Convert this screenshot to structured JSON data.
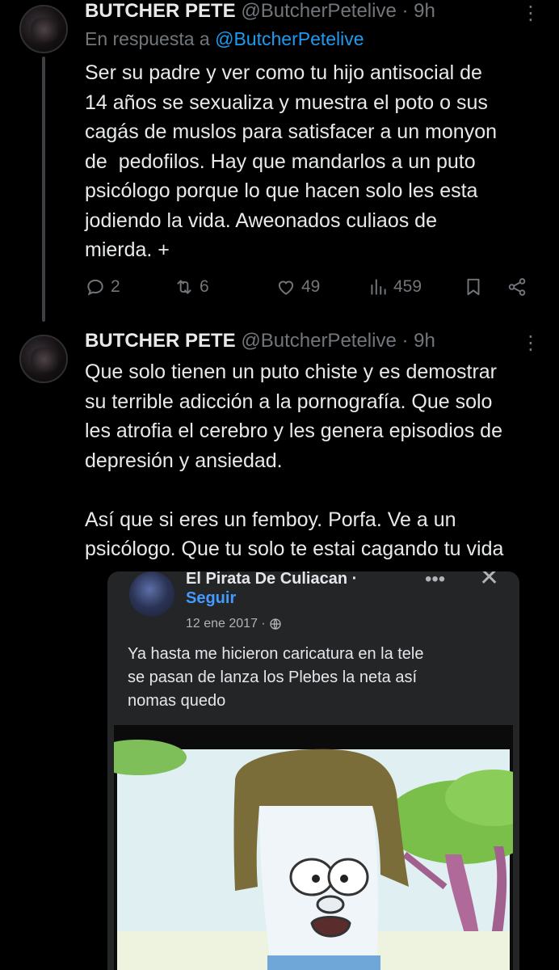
{
  "tweet1": {
    "name": "BUTCHER PETE",
    "handle": "@ButcherPetelive · 9h",
    "reply_prefix": "En respuesta a",
    "reply_mention": "@ButcherPetelive",
    "text": "Ser su padre y ver como tu hijo antisocial de\n14 años se sexualiza y muestra el poto o sus\ncagás de muslos para satisfacer a un monyon\nde  pedofilos. Hay que mandarlos a un puto\npsicólogo porque lo que hacen solo les esta\njodiendo la vida. Aweonados culiaos de\nmierda. +",
    "replies": "2",
    "reposts": "6",
    "likes": "49",
    "views": "459"
  },
  "tweet2": {
    "name": "BUTCHER PETE",
    "handle": "@ButcherPetelive · 9h",
    "text": "Que solo tienen un puto chiste y es demostrar\nsu terrible adicción a la pornografía. Que solo\nles atrofia el cerebro y les genera episodios de\ndepresión y ansiedad.\n\nAsí que si eres un femboy. Porfa. Ve a un\npsicólogo. Que tu solo te estai cagando tu vida"
  },
  "embedded_post": {
    "name": "El Pirata De Culiacan ·",
    "follow": "Seguir",
    "date": "12 ene 2017 ·",
    "text": "Ya hasta me hicieron caricatura en la tele\nse pasan de lanza los Plebes la neta así\nnomas quedo"
  },
  "icons": {
    "more": "more-icon",
    "reply": "reply-icon",
    "repost": "repost-icon",
    "like": "like-icon",
    "views": "views-icon",
    "bookmark": "bookmark-icon",
    "share": "share-icon",
    "globe": "globe-icon",
    "close": "close-icon"
  },
  "colors": {
    "background": "#000000",
    "text": "#e7e9ea",
    "muted": "#71767b",
    "link": "#1d9bf0",
    "fb_card": "#242526",
    "fb_link": "#4599ff"
  }
}
